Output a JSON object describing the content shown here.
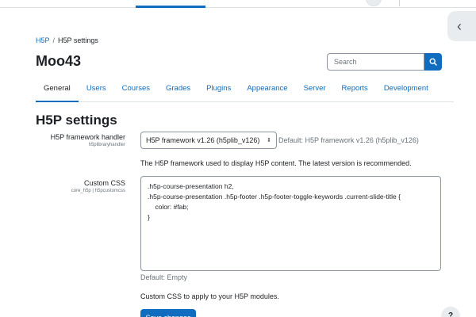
{
  "breadcrumb": {
    "items": [
      "H5P",
      "H5P settings"
    ],
    "separator": "/"
  },
  "course": {
    "title": "Moo43"
  },
  "search": {
    "placeholder": "Search",
    "icon": "search-icon"
  },
  "tabs": [
    {
      "label": "General",
      "active": true
    },
    {
      "label": "Users",
      "active": false
    },
    {
      "label": "Courses",
      "active": false
    },
    {
      "label": "Grades",
      "active": false
    },
    {
      "label": "Plugins",
      "active": false
    },
    {
      "label": "Appearance",
      "active": false
    },
    {
      "label": "Server",
      "active": false
    },
    {
      "label": "Reports",
      "active": false
    },
    {
      "label": "Development",
      "active": false
    }
  ],
  "page": {
    "heading": "H5P settings"
  },
  "settings": {
    "framework": {
      "label": "H5P framework handler",
      "key": "h5plibraryhandler",
      "selected": "H5P framework v1.26 (h5plib_v126)",
      "default": "Default: H5P framework v1.26 (h5plib_v126)",
      "description": "The H5P framework used to display H5P content. The latest version is recommended."
    },
    "custom_css": {
      "label": "Custom CSS",
      "key": "core_h5p | h5pcustomcss",
      "value": ".h5p-course-presentation h2,\n.h5p-course-presentation .h5p-footer .h5p-footer-toggle-keywords .current-slide-title {\n    color: #fab;\n}",
      "default": "Default: Empty",
      "description": "Custom CSS to apply to your H5P modules."
    }
  },
  "actions": {
    "save_label": "Save changes"
  },
  "help": {
    "label": "?"
  },
  "drawer": {
    "icon": "chevron-left-icon",
    "glyph": "‹"
  },
  "colors": {
    "primary": "#0f6cbf",
    "text": "#1d2125",
    "muted": "#6a737b",
    "border": "#8f959e"
  }
}
